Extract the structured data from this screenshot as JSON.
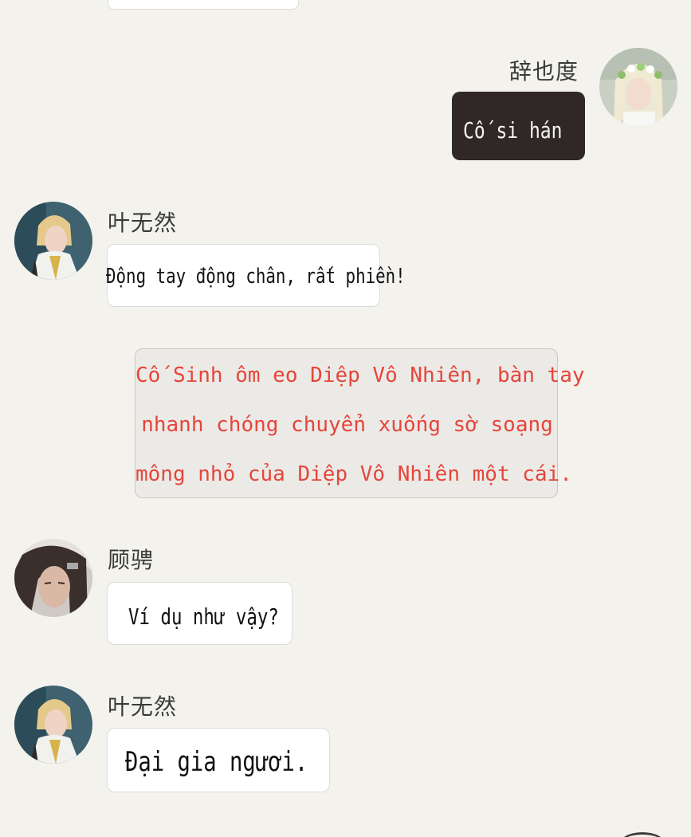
{
  "messages": [
    {
      "id": "m1",
      "side": "right",
      "sender": "辞也度",
      "text": "Cố si hán"
    },
    {
      "id": "m2",
      "side": "left",
      "sender": "叶无然",
      "text": "Động tay động chân, rất phiền!"
    },
    {
      "id": "m3",
      "side": "narration",
      "lines": [
        "Cố Sinh ôm eo Diệp Vô Nhiên, bàn tay",
        "nhanh chóng chuyển xuống sờ soạng",
        "mông nhỏ của Diệp Vô Nhiên một cái."
      ]
    },
    {
      "id": "m4",
      "side": "left",
      "sender": "顾骋",
      "text": "Ví dụ như vậy?"
    },
    {
      "id": "m5",
      "side": "left",
      "sender": "叶无然",
      "text": "Đại gia ngươi."
    }
  ],
  "colors": {
    "background": "#f3f2ec",
    "bubble_left": "#ffffff",
    "bubble_right": "#2f2827",
    "narration_bg": "#ebeae6",
    "narration_text": "#e6453b"
  },
  "icons": {
    "avatar_ciyedu": "blonde-flower-crown-avatar-icon",
    "avatar_yewuran": "blonde-white-robe-avatar-icon",
    "avatar_gucheng": "dark-hair-avatar-icon"
  }
}
